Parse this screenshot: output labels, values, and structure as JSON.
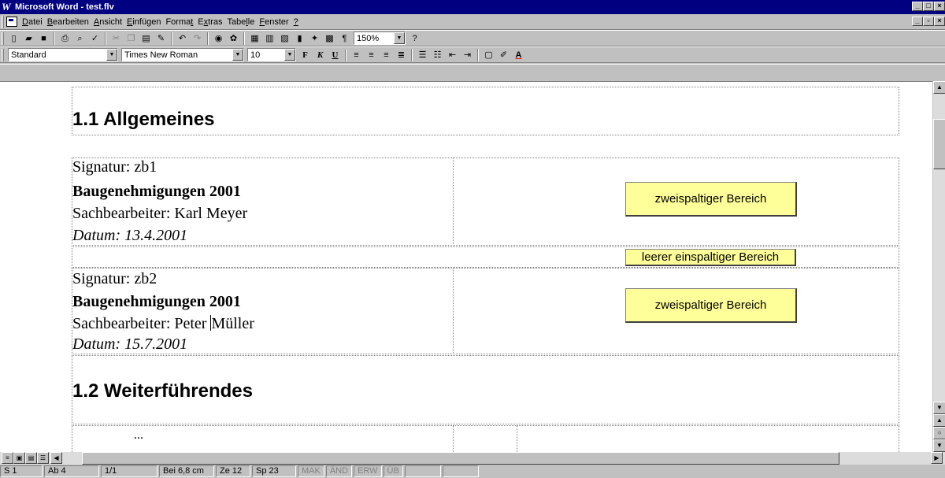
{
  "window": {
    "title": "Microsoft Word - test.flv",
    "app_icon": "W"
  },
  "menu": {
    "items": [
      {
        "pre": "",
        "key": "D",
        "post": "atei"
      },
      {
        "pre": "",
        "key": "B",
        "post": "earbeiten"
      },
      {
        "pre": "",
        "key": "A",
        "post": "nsicht"
      },
      {
        "pre": "",
        "key": "E",
        "post": "infügen"
      },
      {
        "pre": "Forma",
        "key": "t",
        "post": ""
      },
      {
        "pre": "E",
        "key": "x",
        "post": "tras"
      },
      {
        "pre": "Tabe",
        "key": "l",
        "post": "le"
      },
      {
        "pre": "",
        "key": "F",
        "post": "enster"
      },
      {
        "pre": "",
        "key": "?",
        "post": ""
      }
    ]
  },
  "toolbar": {
    "zoom": "150%",
    "style": "Standard",
    "font": "Times New Roman",
    "size": "10",
    "bold_label": "F",
    "italic_label": "K",
    "underline_label": "U"
  },
  "document": {
    "heading1": "1.1 Allgemeines",
    "record1": {
      "signatur": "Signatur: zb1",
      "title": "Baugenehmigungen 2001",
      "bearbeiter": "Sachbearbeiter: Karl Meyer",
      "datum": "Datum: 13.4.2001",
      "box": "zweispaltiger Bereich"
    },
    "empty_box": "leerer einspaltiger Bereich",
    "record2": {
      "signatur": "Signatur: zb2",
      "title": "Baugenehmigungen 2001",
      "bearbeiter_a": "Sachbearbeiter: Peter ",
      "bearbeiter_b": "Müller",
      "datum": "Datum: 15.7.2001",
      "box": "zweispaltiger Bereich"
    },
    "heading2": "1.2 Weiterführendes",
    "ellipsis": "..."
  },
  "status": {
    "page": "S 1",
    "section": "Ab 4",
    "pages": "1/1",
    "position": "Bei 6,8 cm",
    "line": "Ze 12",
    "column": "Sp 23",
    "mak": "MAK",
    "and": "ÄND",
    "erw": "ERW",
    "ub": "ÜB"
  }
}
